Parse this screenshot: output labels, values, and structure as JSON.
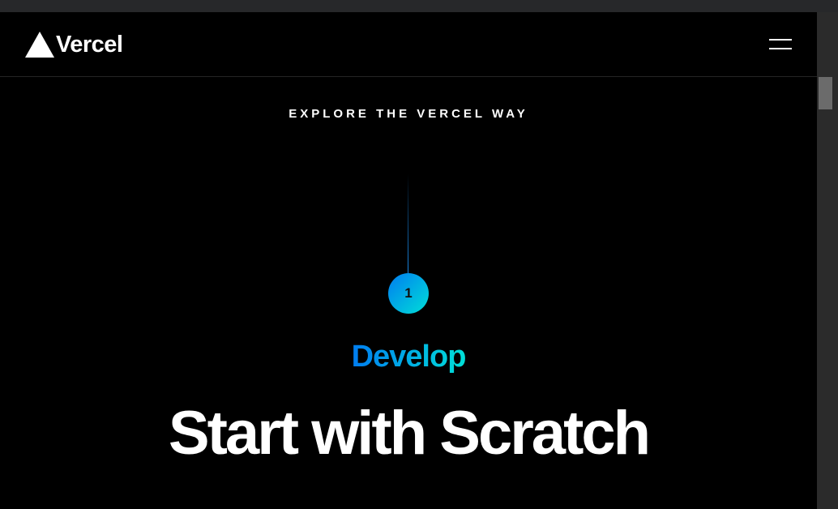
{
  "brand": {
    "name": "Vercel",
    "logo_icon": "triangle-icon"
  },
  "header": {
    "menu_icon": "hamburger-menu-icon"
  },
  "hero": {
    "eyebrow": "EXPLORE THE VERCEL WAY",
    "step_number": "1",
    "step_label": "Develop",
    "headline": "Start with Scratch"
  },
  "colors": {
    "background": "#000000",
    "text": "#ffffff",
    "gradient_start": "#007cf0",
    "gradient_end": "#00dfd8",
    "scrollbar_track": "#2b2b2b",
    "scrollbar_thumb": "#6b6b6b"
  }
}
